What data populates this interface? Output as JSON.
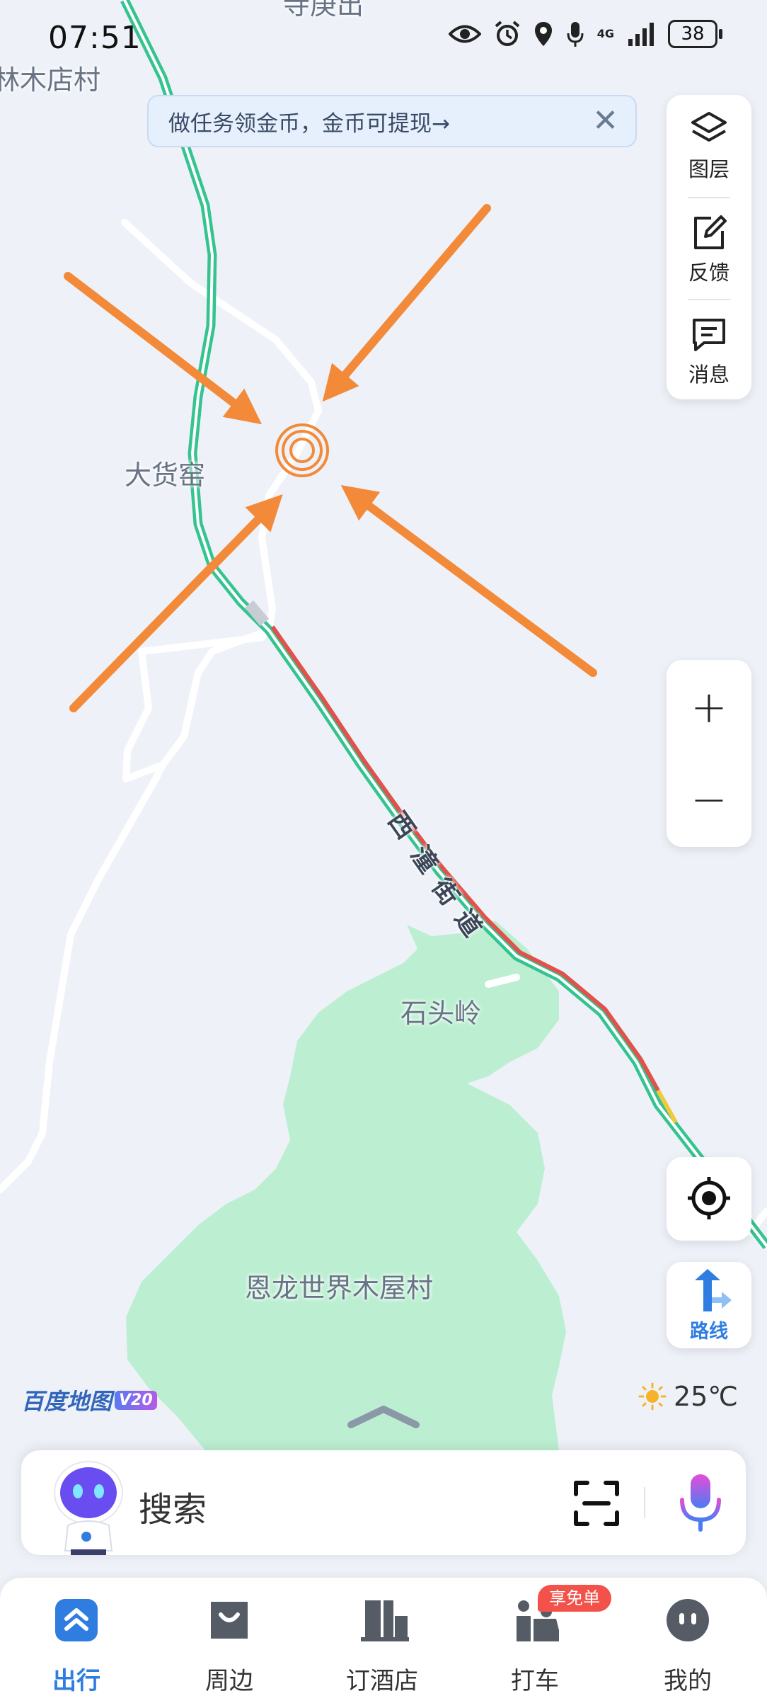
{
  "status_bar": {
    "time": "07:51",
    "network": "4G",
    "battery": "38"
  },
  "banner": {
    "text": "做任务领金币，金币可提现→",
    "close": "✕"
  },
  "tools": {
    "layers": "图层",
    "feedback": "反馈",
    "messages": "消息"
  },
  "zoom": {
    "in": "+",
    "out": "−"
  },
  "map": {
    "labels": {
      "top_partial": "寺庚出",
      "village_top": "林木店村",
      "da_huo_yao": "大货窑",
      "shi_tou_ling": "石头岭",
      "enlong": "恩龙世界木屋村"
    },
    "road_chars": [
      "西",
      "潼",
      "街",
      "道"
    ]
  },
  "route": {
    "label": "路线"
  },
  "brand": {
    "name": "百度地图",
    "version": "V20"
  },
  "weather": {
    "temp": "25℃"
  },
  "search": {
    "placeholder": "搜索"
  },
  "nav": {
    "travel": "出行",
    "nearby": "周边",
    "hotel": "订酒店",
    "taxi": "打车",
    "mine": "我的",
    "taxi_badge": "享免单"
  },
  "colors": {
    "accent": "#2f7de1",
    "road_green": "#35c38f",
    "road_red": "#e0524b",
    "road_yellow": "#f3c83d",
    "arrow": "#f28a3a",
    "park": "#bcefd2",
    "badge": "#f2524a"
  }
}
